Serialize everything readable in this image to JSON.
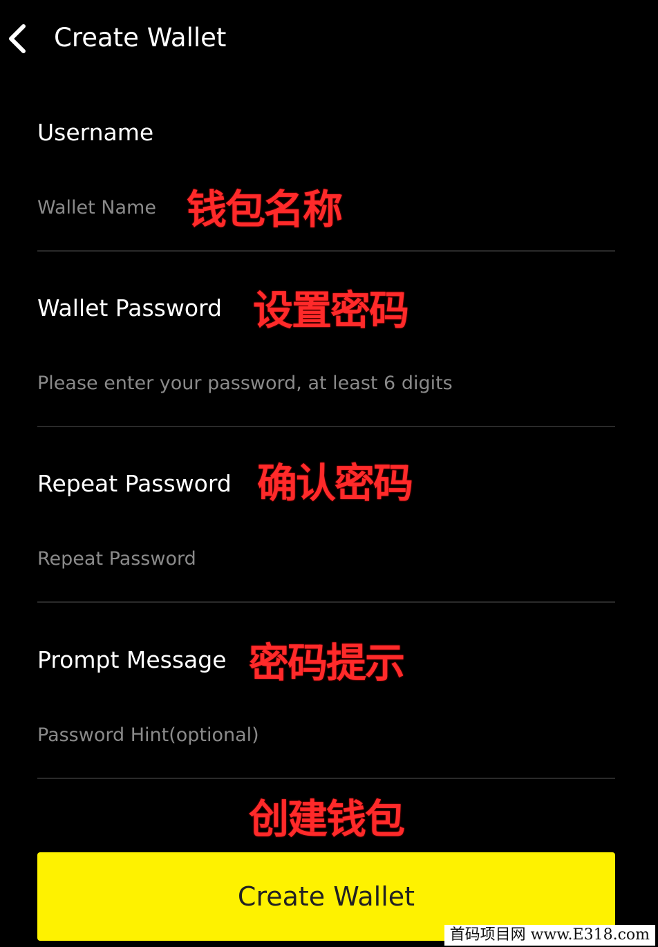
{
  "header": {
    "title": "Create Wallet",
    "back_icon": "chevron-left-icon"
  },
  "form": {
    "username": {
      "label": "Username",
      "placeholder": "Wallet Name",
      "annotation": "钱包名称"
    },
    "password": {
      "label": "Wallet Password",
      "placeholder": "Please enter your password, at least 6 digits",
      "annotation": "设置密码"
    },
    "repeat_password": {
      "label": "Repeat Password",
      "placeholder": "Repeat Password",
      "annotation": "确认密码"
    },
    "hint": {
      "label": "Prompt Message",
      "placeholder": "Password Hint(optional)",
      "annotation": "密码提示"
    }
  },
  "submit": {
    "label": "Create Wallet",
    "annotation": "创建钱包"
  },
  "watermark": "首码项目网 www.E318.com",
  "colors": {
    "background": "#000000",
    "accent": "#fef200",
    "annotation": "#ff2a2a",
    "placeholder": "#8a8a8a",
    "divider": "#2a2a2a"
  }
}
